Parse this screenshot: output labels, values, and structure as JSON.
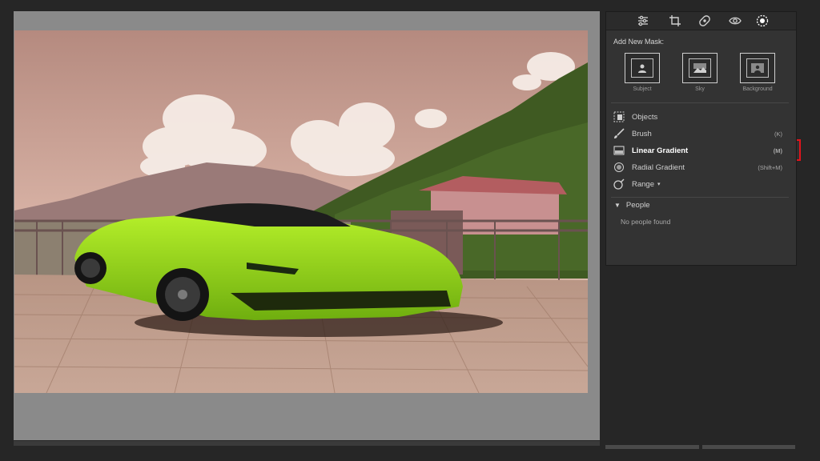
{
  "toolbar": {
    "icons": [
      "sliders-icon",
      "crop-icon",
      "heal-icon",
      "red-eye-icon",
      "masking-icon"
    ]
  },
  "mask": {
    "section_title": "Add New Mask:",
    "buttons": [
      {
        "label": "Subject",
        "icon": "subject-icon"
      },
      {
        "label": "Sky",
        "icon": "sky-icon"
      },
      {
        "label": "Background",
        "icon": "background-icon"
      }
    ]
  },
  "tools": [
    {
      "label": "Objects",
      "shortcut": "",
      "icon": "objects-icon"
    },
    {
      "label": "Brush",
      "shortcut": "(K)",
      "icon": "brush-icon"
    },
    {
      "label": "Linear Gradient",
      "shortcut": "(M)",
      "icon": "linear-gradient-icon",
      "selected": true
    },
    {
      "label": "Radial Gradient",
      "shortcut": "(Shift+M)",
      "icon": "radial-gradient-icon"
    },
    {
      "label": "Range",
      "shortcut": "",
      "icon": "range-icon"
    }
  ],
  "people": {
    "title": "People",
    "empty_text": "No people found"
  },
  "colors": {
    "highlight": "#e0141c",
    "car": "#8fd21a",
    "background": "#262626"
  },
  "photo": {
    "description_icon": "photo-preview"
  }
}
